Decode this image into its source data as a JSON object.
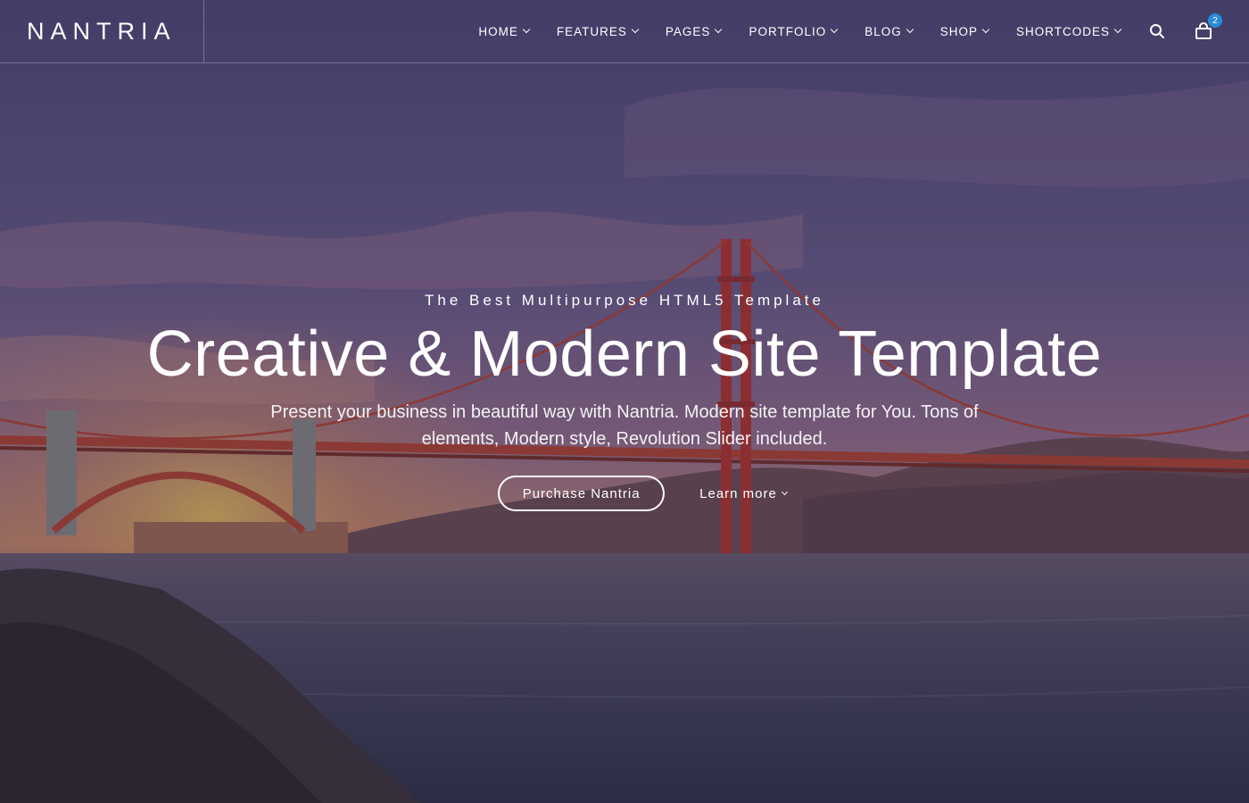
{
  "brand": {
    "logo": "NANTRIA"
  },
  "nav": {
    "items": [
      {
        "label": "HOME"
      },
      {
        "label": "FEATURES"
      },
      {
        "label": "PAGES"
      },
      {
        "label": "PORTFOLIO"
      },
      {
        "label": "BLOG"
      },
      {
        "label": "SHOP"
      },
      {
        "label": "SHORTCODES"
      }
    ],
    "search_icon": "search-icon",
    "cart_icon": "cart-icon",
    "cart_count": "2"
  },
  "hero": {
    "eyebrow": "The Best Multipurpose HTML5 Template",
    "title": "Creative & Modern Site Template",
    "description": "Present your business in beautiful way with Nantria. Modern site template for You. Tons of elements, Modern style, Revolution Slider included.",
    "primary_button": "Purchase Nantria",
    "secondary_link": "Learn more"
  },
  "colors": {
    "badge": "#2a8bd6",
    "overlay": "#3a3550"
  }
}
